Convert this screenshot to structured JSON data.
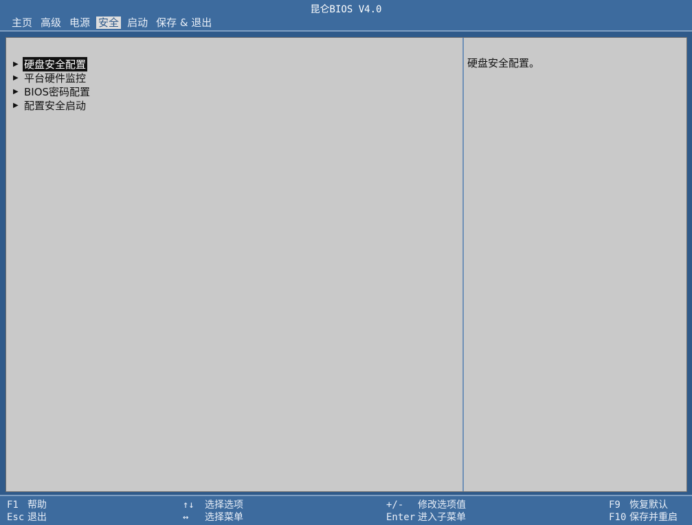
{
  "header": {
    "title": "昆仑BIOS V4.0",
    "menu": [
      {
        "label": "主页"
      },
      {
        "label": "高级"
      },
      {
        "label": "电源"
      },
      {
        "label": "安全",
        "active": true
      },
      {
        "label": "启动"
      },
      {
        "label": "保存 & 退出"
      }
    ]
  },
  "security_menu": {
    "items": [
      {
        "label": "硬盘安全配置",
        "selected": true
      },
      {
        "label": "平台硬件监控"
      },
      {
        "label": "BIOS密码配置"
      },
      {
        "label": "配置安全启动"
      }
    ],
    "help": "硬盘安全配置。"
  },
  "footer": {
    "hints": [
      {
        "key": "F1",
        "desc": "帮助"
      },
      {
        "key": "Esc",
        "desc": "退出"
      },
      {
        "key": "↑↓",
        "desc": "选择选项"
      },
      {
        "key": "↔",
        "desc": "选择菜单"
      },
      {
        "key": "+/-",
        "desc": "修改选项值"
      },
      {
        "key": "Enter",
        "desc": "进入子菜单"
      },
      {
        "key": "F9",
        "desc": "恢复默认"
      },
      {
        "key": "F10",
        "desc": "保存并重启"
      }
    ]
  },
  "colors": {
    "bar_blue": "#3d6b9e",
    "panel_gray": "#c9c9c9",
    "selected_bg": "#111111",
    "active_tab_bg": "#dedede"
  }
}
